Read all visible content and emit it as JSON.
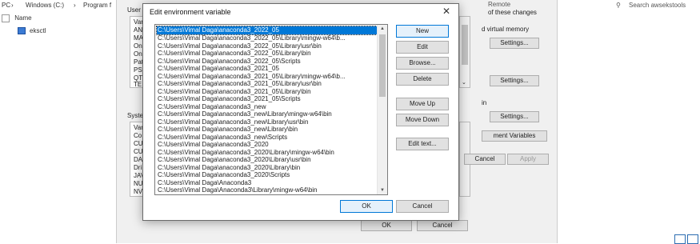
{
  "explorer": {
    "breadcrumb": [
      "PC",
      "Windows (C:)",
      "Program f"
    ],
    "search_placeholder": "Search awsekstools",
    "column_name": "Name",
    "files": [
      "eksctl"
    ]
  },
  "sysprop": {
    "user_label": "User",
    "system_label": "Syste",
    "user_vars": [
      "Var",
      "AN",
      "MA",
      "On",
      "On",
      "Pat",
      "PS",
      "QT",
      "TE"
    ],
    "system_vars": [
      "Var",
      "Co",
      "CU",
      "CU",
      "DA",
      "Dri",
      "JAV",
      "NU",
      "NV"
    ],
    "right_texts": [
      "Remote",
      "of these changes",
      "d virtual memory",
      "in",
      "ment Variables"
    ],
    "settings_label": "Settings...",
    "env_vars_label": "ment Variables",
    "ok_label": "OK",
    "cancel_label": "Cancel",
    "apply_label": "Apply"
  },
  "dialog": {
    "title": "Edit environment variable",
    "entries": [
      "C:\\Users\\Vimal Daga\\anaconda3_2022_05",
      "C:\\Users\\Vimal Daga\\anaconda3_2022_05\\Library\\mingw-w64\\b...",
      "C:\\Users\\Vimal Daga\\anaconda3_2022_05\\Library\\usr\\bin",
      "C:\\Users\\Vimal Daga\\anaconda3_2022_05\\Library\\bin",
      "C:\\Users\\Vimal Daga\\anaconda3_2022_05\\Scripts",
      "C:\\Users\\Vimal Daga\\anaconda3_2021_05",
      "C:\\Users\\Vimal Daga\\anaconda3_2021_05\\Library\\mingw-w64\\b...",
      "C:\\Users\\Vimal Daga\\anaconda3_2021_05\\Library\\usr\\bin",
      "C:\\Users\\Vimal Daga\\anaconda3_2021_05\\Library\\bin",
      "C:\\Users\\Vimal Daga\\anaconda3_2021_05\\Scripts",
      "C:\\Users\\Vimal Daga\\anaconda3_new",
      "C:\\Users\\Vimal Daga\\anaconda3_new\\Library\\mingw-w64\\bin",
      "C:\\Users\\Vimal Daga\\anaconda3_new\\Library\\usr\\bin",
      "C:\\Users\\Vimal Daga\\anaconda3_new\\Library\\bin",
      "C:\\Users\\Vimal Daga\\anaconda3_new\\Scripts",
      "C:\\Users\\Vimal Daga\\anaconda3_2020",
      "C:\\Users\\Vimal Daga\\anaconda3_2020\\Library\\mingw-w64\\bin",
      "C:\\Users\\Vimal Daga\\anaconda3_2020\\Library\\usr\\bin",
      "C:\\Users\\Vimal Daga\\anaconda3_2020\\Library\\bin",
      "C:\\Users\\Vimal Daga\\anaconda3_2020\\Scripts",
      "C:\\Users\\Vimal Daga\\Anaconda3",
      "C:\\Users\\Vimal Daga\\Anaconda3\\Library\\mingw-w64\\bin"
    ],
    "buttons": {
      "new": "New",
      "edit": "Edit",
      "browse": "Browse...",
      "delete": "Delete",
      "move_up": "Move Up",
      "move_down": "Move Down",
      "edit_text": "Edit text...",
      "ok": "OK",
      "cancel": "Cancel"
    },
    "colors": {
      "selection": "#0078d7",
      "focus_border": "#0078d7"
    }
  }
}
